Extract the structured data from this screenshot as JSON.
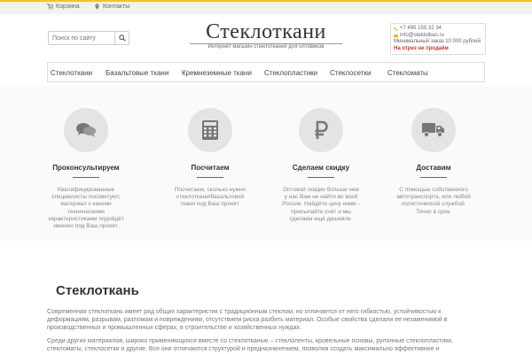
{
  "topbar": {
    "cart_label": "Корзина",
    "contacts_label": "Контакты"
  },
  "search": {
    "placeholder": "Поиск по сайту"
  },
  "header": {
    "title": "Стеклоткани",
    "subtitle": "Интернет магазин стеклотканей для оптовиков"
  },
  "contact": {
    "phone": "+7 495 155 32 34",
    "email": "info@steklotkan.ru",
    "min_order": "Минимальный заказ 10 000 рублей",
    "cut_note": "На отрез не продаём"
  },
  "nav": {
    "items": [
      {
        "label": "Стеклоткани"
      },
      {
        "label": "Базальтовые ткани"
      },
      {
        "label": "Кремнеземные ткани"
      },
      {
        "label": "Стеклопластики"
      },
      {
        "label": "Стеклосетки"
      },
      {
        "label": "Стекломаты"
      }
    ]
  },
  "features": [
    {
      "icon": "chat-bubbles-icon",
      "title": "Проконсультируем",
      "desc": "Квалифицированные специалисты посоветуют, материал с какими техническими характеристиками подойдёт именно под Ваш проект."
    },
    {
      "icon": "calculator-icon",
      "title": "Посчитаем",
      "desc": "Посчитаем, сколько нужно стеклоткани/базальтовой ткани под Ваш проект."
    },
    {
      "icon": "ruble-icon",
      "title": "Сделаем скидку",
      "desc": "Оптовой скидки больше чем у нас Вам не найти во всей России. Найдёте цену ниже - присылайте счёт и мы сделаем ещё дешевле."
    },
    {
      "icon": "truck-icon",
      "title": "Доставим",
      "desc": "С помощью собственного автотранспорта, или любой логистической службой. Точно в срок."
    }
  ],
  "content": {
    "title": "Стеклоткань",
    "para1": "Современная стеклоткань имеет ряд общих характеристик с традиционным стеклом, но отличается от него гибкостью, устойчивостью к деформациям, разрывам, разломам и повреждениям, отсутствием риска разбить материал. Особые свойства сделали ее незаменимой в производственных и промышленных сферах, в строительстве и хозяйственных нуждах.",
    "para2": "Среди других материалов, широко применяющихся вместе со стеклотканью – стеклоленты, кровельные основы, рулонные стеклопластики, стекломаты, стеклосетки и другие. Все они отличаются структурой и предназначением, позволяя создать максимально эффективное и"
  },
  "colors": {
    "accent": "#f2c22a",
    "feature_underline": "#dd3333",
    "warning_text": "#c0392b"
  }
}
